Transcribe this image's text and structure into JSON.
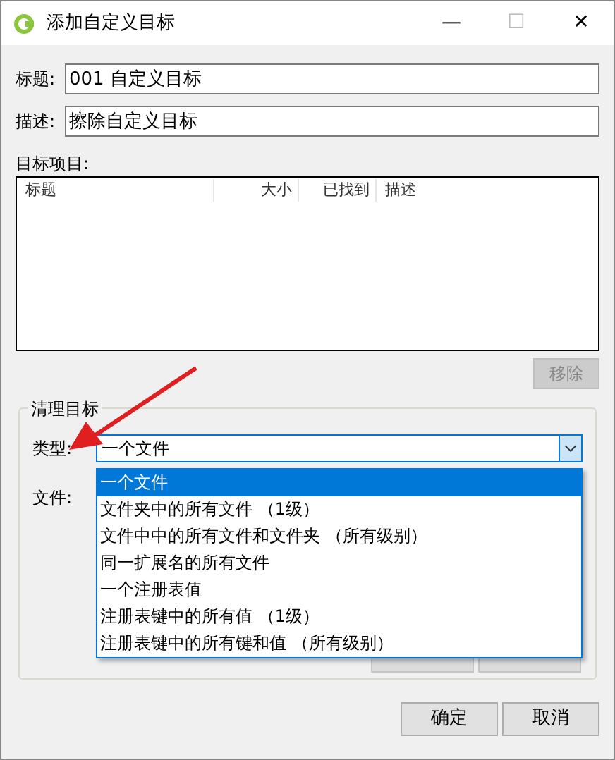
{
  "window": {
    "title": "添加自定义目标",
    "controls": [
      "—",
      "☐",
      "✕"
    ]
  },
  "title_field": {
    "label": "标题:",
    "value": "001 自定义目标"
  },
  "description_field": {
    "label": "描述:",
    "value": "擦除自定义目标"
  },
  "target_items": {
    "label": "目标项目:",
    "columns": [
      "标题",
      "大小",
      "已找到",
      "描述"
    ],
    "remove_button": {
      "label": "移除",
      "disabled": true
    }
  },
  "clean_target": {
    "legend": "清理目标",
    "type_label": "类型:",
    "type_value": "一个文件",
    "file_label": "文件:",
    "dropdown_options": [
      {
        "label": "一个文件",
        "selected": true
      },
      {
        "label": "文件夹中的所有文件 （1级）",
        "selected": false
      },
      {
        "label": "文件中中的所有文件和文件夹 （所有级别）",
        "selected": false
      },
      {
        "label": "同一扩展名的所有文件",
        "selected": false
      },
      {
        "label": "一个注册表值",
        "selected": false
      },
      {
        "label": "注册表键中的所有值 （1级）",
        "selected": false
      },
      {
        "label": "注册表键中的所有键和值 （所有级别）",
        "selected": false
      }
    ]
  },
  "buttons": [
    {
      "label": "确定"
    },
    {
      "label": "取消"
    }
  ]
}
